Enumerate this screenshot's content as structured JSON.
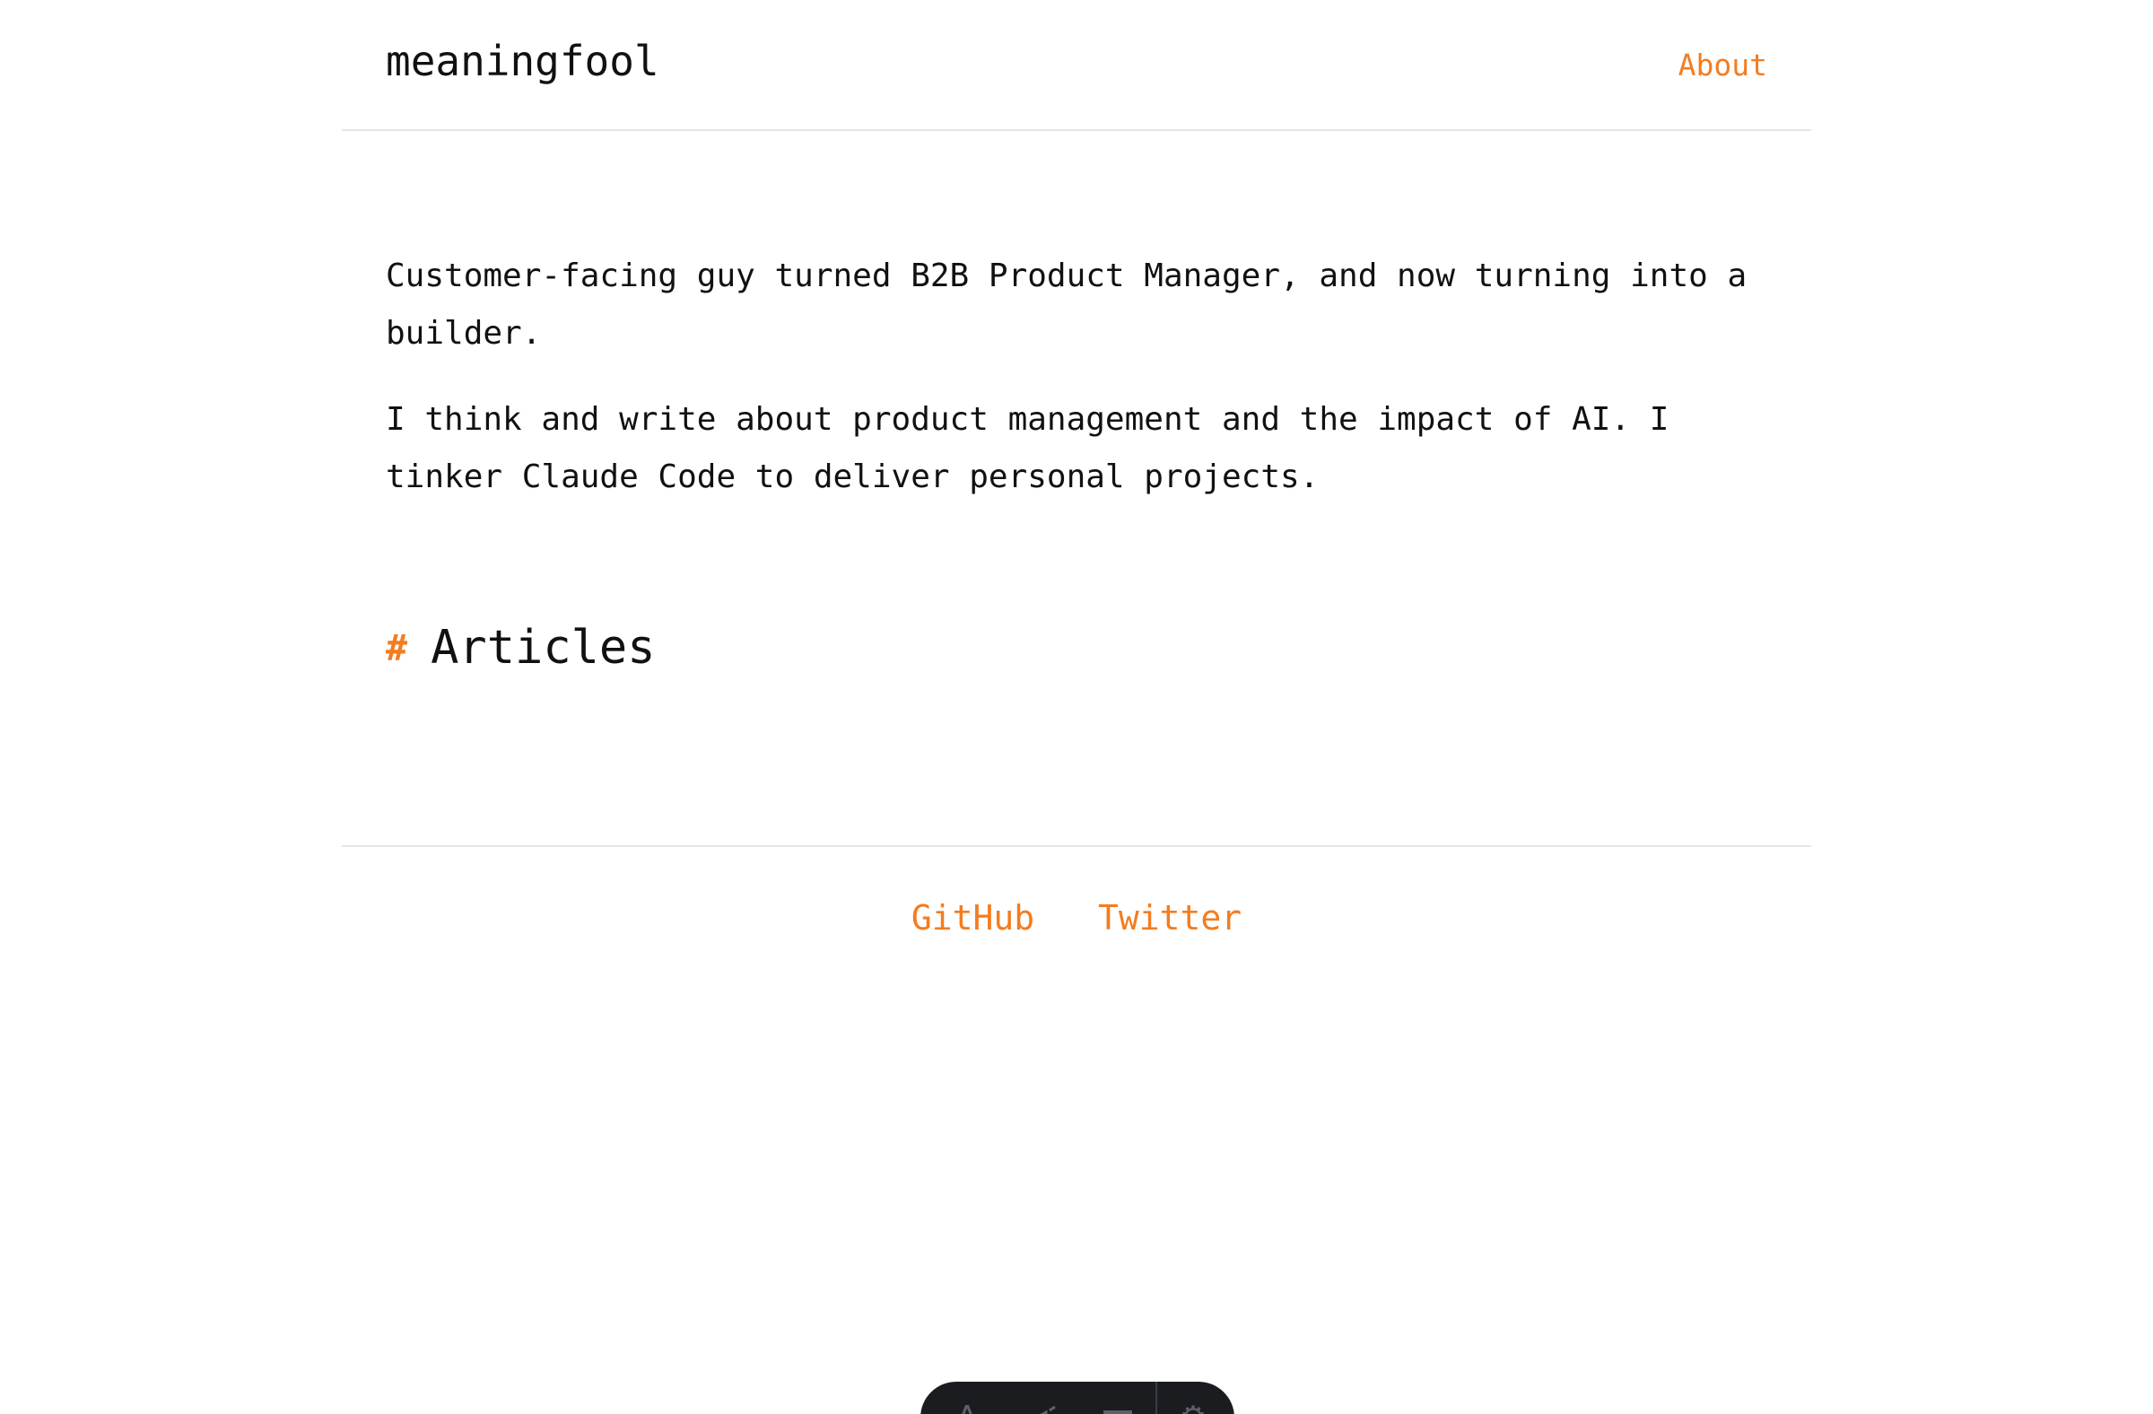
{
  "header": {
    "site_title": "meaningfool",
    "nav": {
      "about_label": "About"
    }
  },
  "bio": {
    "paragraph_1": "Customer-facing guy turned B2B Product Manager, and now turning into a builder.",
    "paragraph_2": "I think and write about product management and the impact of AI. I tinker Claude Code to deliver personal projects."
  },
  "articles": {
    "hash_symbol": "#",
    "heading": "Articles"
  },
  "footer": {
    "github_label": "GitHub",
    "twitter_label": "Twitter"
  },
  "toolbar": {
    "icons": [
      "text-icon",
      "megaphone-icon",
      "menu-icon",
      "gear-icon"
    ]
  },
  "colors": {
    "accent": "#f47c20",
    "text": "#111111",
    "divider": "#e6e6e6",
    "toolbar_bg": "#1b1c20"
  }
}
